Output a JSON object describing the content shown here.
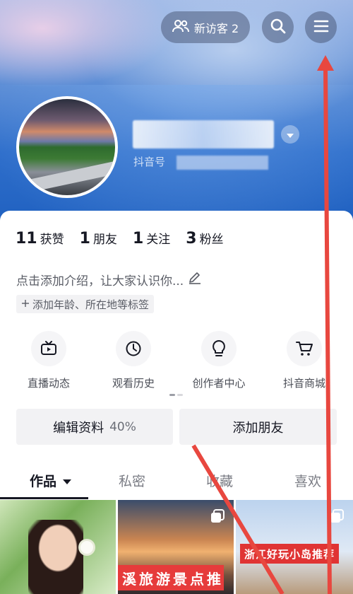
{
  "header": {
    "visitors_label": "新访客 2",
    "icons": [
      "visitors-icon",
      "search-icon",
      "menu-icon",
      "dropdown-icon"
    ]
  },
  "profile": {
    "douyin_id_prefix": "抖音号"
  },
  "stats": [
    {
      "num": "11",
      "label": "获赞"
    },
    {
      "num": "1",
      "label": "朋友"
    },
    {
      "num": "1",
      "label": "关注"
    },
    {
      "num": "3",
      "label": "粉丝"
    }
  ],
  "bio": {
    "text": "点击添加介绍，让大家认识你...",
    "tag_chip": "添加年龄、所在地等标签"
  },
  "shortcuts": [
    {
      "label": "直播动态",
      "icon": "tv-icon"
    },
    {
      "label": "观看历史",
      "icon": "clock-icon"
    },
    {
      "label": "创作者中心",
      "icon": "lightbulb-icon"
    },
    {
      "label": "抖音商城",
      "icon": "cart-icon"
    }
  ],
  "actions": {
    "edit_profile": "编辑资料",
    "edit_percent": "40%",
    "add_friends": "添加朋友"
  },
  "tabs": [
    "作品",
    "私密",
    "收藏",
    "喜欢"
  ],
  "thumbnails": [
    {
      "caption": ""
    },
    {
      "caption": "溪旅游景点推"
    },
    {
      "caption": "浙江好玩小岛推荐"
    }
  ],
  "colors": {
    "accent_red": "#e63b3b",
    "banner_blue": "#2f6fcb",
    "annotation_red": "#e8473f"
  }
}
